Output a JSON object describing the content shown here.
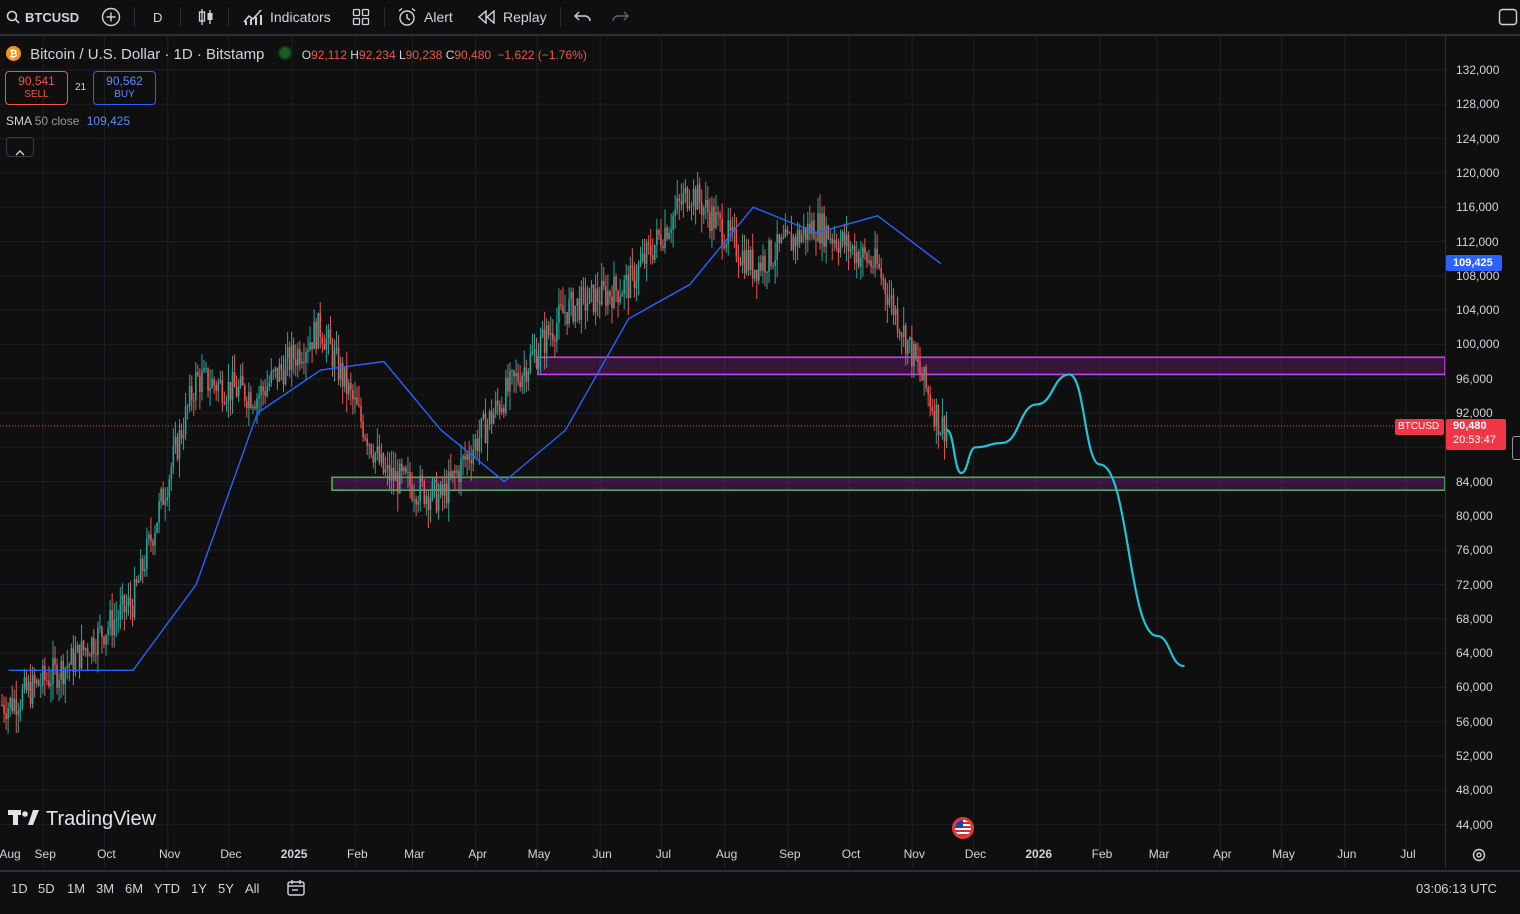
{
  "toolbar": {
    "symbol": "BTCUSD",
    "interval": "D",
    "indicators_label": "Indicators",
    "alert_label": "Alert",
    "replay_label": "Replay"
  },
  "legend": {
    "title": "Bitcoin / U.S. Dollar · 1D · Bitstamp",
    "open_label": "O",
    "open": "92,112",
    "high_label": "H",
    "high": "92,234",
    "low_label": "L",
    "low": "90,238",
    "close_label": "C",
    "close": "90,480",
    "change": "−1,622 (−1.76%)",
    "sell_price": "90,541",
    "sell_label": "SELL",
    "spread": "21",
    "buy_price": "90,562",
    "buy_label": "BUY",
    "sma_label": "SMA",
    "sma_params": "50 close",
    "sma_value": "109,425"
  },
  "price_axis": {
    "ticks": [
      "132,000",
      "128,000",
      "124,000",
      "120,000",
      "116,000",
      "112,000",
      "108,000",
      "104,000",
      "100,000",
      "96,000",
      "92,000",
      "84,000",
      "80,000",
      "76,000",
      "72,000",
      "68,000",
      "64,000",
      "60,000",
      "56,000",
      "52,000",
      "48,000",
      "44,000"
    ],
    "sma_badge": "109,425",
    "symbol_badge": "BTCUSD",
    "last_price_badge": "90,480",
    "countdown": "20:53:47"
  },
  "time_axis": {
    "ticks": [
      "Aug",
      "Sep",
      "Oct",
      "Nov",
      "Dec",
      "2025",
      "Feb",
      "Mar",
      "Apr",
      "May",
      "Jun",
      "Jul",
      "Aug",
      "Sep",
      "Oct",
      "Nov",
      "Dec",
      "2026",
      "Feb",
      "Mar",
      "Apr",
      "May",
      "Jun",
      "Jul"
    ]
  },
  "bottom": {
    "ranges": [
      "1D",
      "5D",
      "1M",
      "3M",
      "6M",
      "YTD",
      "1Y",
      "5Y",
      "All"
    ],
    "clock": "03:06:13 UTC"
  },
  "watermark": "TradingView",
  "colors": {
    "up": "#26a69a",
    "down": "#ef5350",
    "sma": "#2962ff",
    "zone_resistance": "#c840e9",
    "zone_support": "#4caf50",
    "projection": "#22c3d6",
    "background": "#0f0f0f",
    "grid": "#1c1f26"
  },
  "chart_data": {
    "type": "candlestick",
    "symbol": "BTCUSD",
    "interval": "1D",
    "ylim": [
      42000,
      134000
    ],
    "series_approx_close": [
      {
        "t": "2024-08",
        "v": 58000
      },
      {
        "t": "2024-09",
        "v": 63000
      },
      {
        "t": "2024-10",
        "v": 70000
      },
      {
        "t": "2024-11",
        "v": 96000
      },
      {
        "t": "2024-12",
        "v": 94000
      },
      {
        "t": "2025-01",
        "v": 102000
      },
      {
        "t": "2025-02",
        "v": 85000
      },
      {
        "t": "2025-03",
        "v": 82000
      },
      {
        "t": "2025-04",
        "v": 94000
      },
      {
        "t": "2025-05",
        "v": 104000
      },
      {
        "t": "2025-06",
        "v": 107000
      },
      {
        "t": "2025-07",
        "v": 118000
      },
      {
        "t": "2025-08",
        "v": 109000
      },
      {
        "t": "2025-09",
        "v": 114000
      },
      {
        "t": "2025-10",
        "v": 109000
      },
      {
        "t": "2025-11",
        "v": 90480
      }
    ],
    "sma50_approx": [
      {
        "t": "2024-08",
        "v": 62000
      },
      {
        "t": "2024-10",
        "v": 62000
      },
      {
        "t": "2024-11",
        "v": 72000
      },
      {
        "t": "2024-12",
        "v": 92000
      },
      {
        "t": "2025-01",
        "v": 97000
      },
      {
        "t": "2025-02",
        "v": 98000
      },
      {
        "t": "2025-03",
        "v": 90000
      },
      {
        "t": "2025-04",
        "v": 84000
      },
      {
        "t": "2025-05",
        "v": 90000
      },
      {
        "t": "2025-06",
        "v": 103000
      },
      {
        "t": "2025-07",
        "v": 107000
      },
      {
        "t": "2025-08",
        "v": 116000
      },
      {
        "t": "2025-09",
        "v": 113000
      },
      {
        "t": "2025-10",
        "v": 115000
      },
      {
        "t": "2025-11",
        "v": 109425
      }
    ],
    "zones": [
      {
        "from": 96500,
        "to": 98500
      },
      {
        "from": 83000,
        "to": 84500
      }
    ],
    "projection": [
      {
        "t": "2025-11-18",
        "v": 90000
      },
      {
        "t": "2025-11-25",
        "v": 85000
      },
      {
        "t": "2025-12-02",
        "v": 88000
      },
      {
        "t": "2025-12-15",
        "v": 88500
      },
      {
        "t": "2026-01-01",
        "v": 93000
      },
      {
        "t": "2026-01-17",
        "v": 96500
      },
      {
        "t": "2026-02-01",
        "v": 86000
      },
      {
        "t": "2026-03-01",
        "v": 66000
      },
      {
        "t": "2026-03-14",
        "v": 62500
      }
    ]
  }
}
